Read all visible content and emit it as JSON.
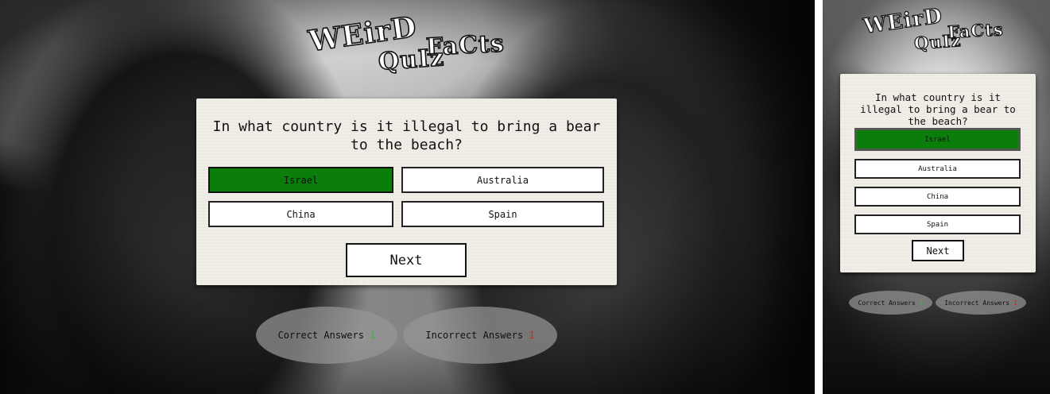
{
  "logo": {
    "word1": "WEirD",
    "word2": "FaCts",
    "word3": "QuIz"
  },
  "quiz": {
    "question": "In what country is it illegal to bring a bear to the beach?",
    "answers": [
      {
        "label": "Israel",
        "state": "correct"
      },
      {
        "label": "Australia",
        "state": "default"
      },
      {
        "label": "China",
        "state": "default"
      },
      {
        "label": "Spain",
        "state": "default"
      }
    ],
    "next_label": "Next"
  },
  "score": {
    "correct_label": "Correct Answers",
    "correct_count": "1",
    "incorrect_label": "Incorrect Answers",
    "incorrect_count": "1"
  },
  "colors": {
    "correct_answer": "#0b7d0b",
    "correct_count": "#27c227",
    "incorrect_count": "#e02020"
  }
}
